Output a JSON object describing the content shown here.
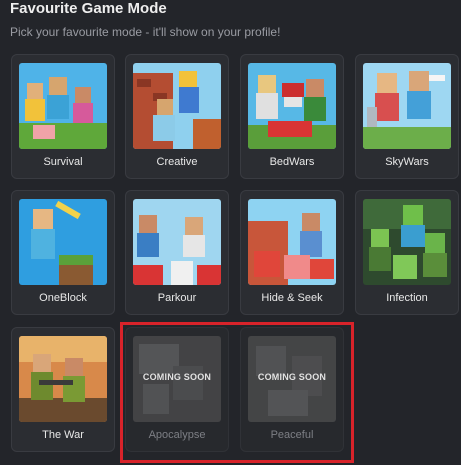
{
  "header": {
    "title": "Favourite Game Mode",
    "subtitle": "Pick your favourite mode - it'll show on your profile!"
  },
  "modes": [
    {
      "label": "Survival",
      "status": "available",
      "icon": "survival-thumbnail"
    },
    {
      "label": "Creative",
      "status": "available",
      "icon": "creative-thumbnail"
    },
    {
      "label": "BedWars",
      "status": "available",
      "icon": "bedwars-thumbnail"
    },
    {
      "label": "SkyWars",
      "status": "available",
      "icon": "skywars-thumbnail"
    },
    {
      "label": "OneBlock",
      "status": "available",
      "icon": "oneblock-thumbnail"
    },
    {
      "label": "Parkour",
      "status": "available",
      "icon": "parkour-thumbnail"
    },
    {
      "label": "Hide & Seek",
      "status": "available",
      "icon": "hide-and-seek-thumbnail"
    },
    {
      "label": "Infection",
      "status": "available",
      "icon": "infection-thumbnail"
    },
    {
      "label": "The War",
      "status": "available",
      "icon": "the-war-thumbnail"
    },
    {
      "label": "Apocalypse",
      "status": "coming-soon",
      "badge": "COMING SOON",
      "icon": "apocalypse-thumbnail"
    },
    {
      "label": "Peaceful",
      "status": "coming-soon",
      "badge": "COMING SOON",
      "icon": "peaceful-thumbnail"
    }
  ],
  "colors": {
    "background": "#23252a",
    "card": "#2b2d32",
    "highlight": "#d8232a"
  }
}
